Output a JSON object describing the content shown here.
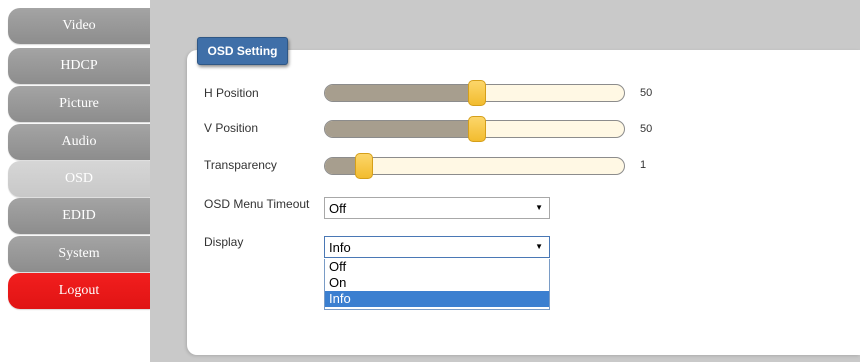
{
  "sidebar": {
    "items": [
      {
        "label": "Video"
      },
      {
        "label": "HDCP"
      },
      {
        "label": "Picture"
      },
      {
        "label": "Audio"
      },
      {
        "label": "OSD",
        "active": true
      },
      {
        "label": "EDID"
      },
      {
        "label": "System"
      },
      {
        "label": "Logout"
      }
    ]
  },
  "section": {
    "title": "OSD Setting"
  },
  "settings": {
    "h_position": {
      "label": "H Position",
      "value": "50",
      "level": 0.5
    },
    "v_position": {
      "label": "V Position",
      "value": "50",
      "level": 0.5
    },
    "transparency": {
      "label": "Transparency",
      "value": "1",
      "level": 0.12
    },
    "osd_menu_timeout": {
      "label": "OSD Menu Timeout",
      "selected": "Off"
    },
    "display": {
      "label": "Display",
      "selected": "Info",
      "options": [
        "Off",
        "On",
        "Info"
      ]
    }
  },
  "colors": {
    "accent": "#3f6fa8",
    "logout": "#e81818",
    "slider_fill": "#a79e8e",
    "slider_handle": "#f5c542",
    "selected_option": "#3b7fd0"
  }
}
